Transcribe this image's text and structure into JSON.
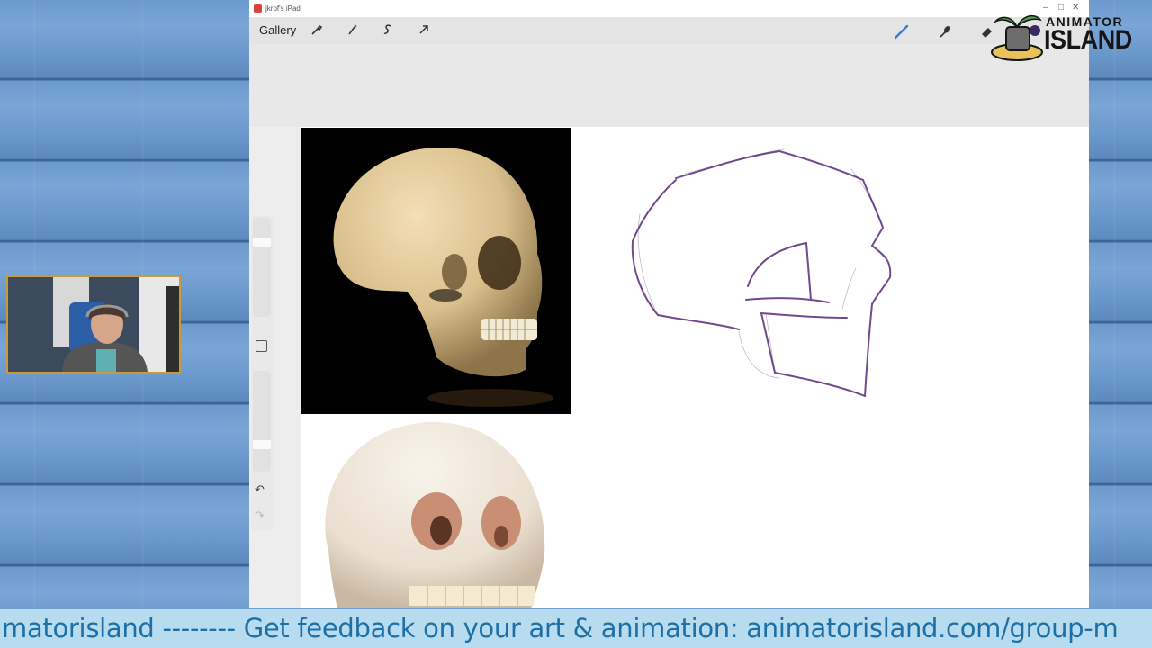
{
  "window": {
    "title": "jkrof's iPad",
    "gallery_label": "Gallery",
    "tools_left": [
      "wrench-icon",
      "magic-wand-icon",
      "selection-icon",
      "transform-arrow-icon"
    ],
    "tools_right": [
      "brush-icon",
      "smudge-icon",
      "eraser-icon",
      "layers-icon"
    ],
    "controls": [
      "minimize",
      "maximize",
      "close"
    ]
  },
  "sidebar": {
    "brush_size_level": 0.78,
    "opacity_level": 0.25
  },
  "reference_images": [
    "skull-side-photo",
    "skull-front-photo"
  ],
  "logo": {
    "top": "ANIMATOR",
    "bottom": "ISLAND"
  },
  "ticker": {
    "text": "matorisland -------- Get feedback on your art & animation: animatorisland.com/group-m"
  },
  "colors": {
    "accent_brush": "#2f7fd8",
    "sketch_stroke": "#5a2a7a",
    "ticker_text": "#1e6fa6",
    "ticker_bg": "#b7dcf0",
    "webcam_border": "#c99a35"
  }
}
